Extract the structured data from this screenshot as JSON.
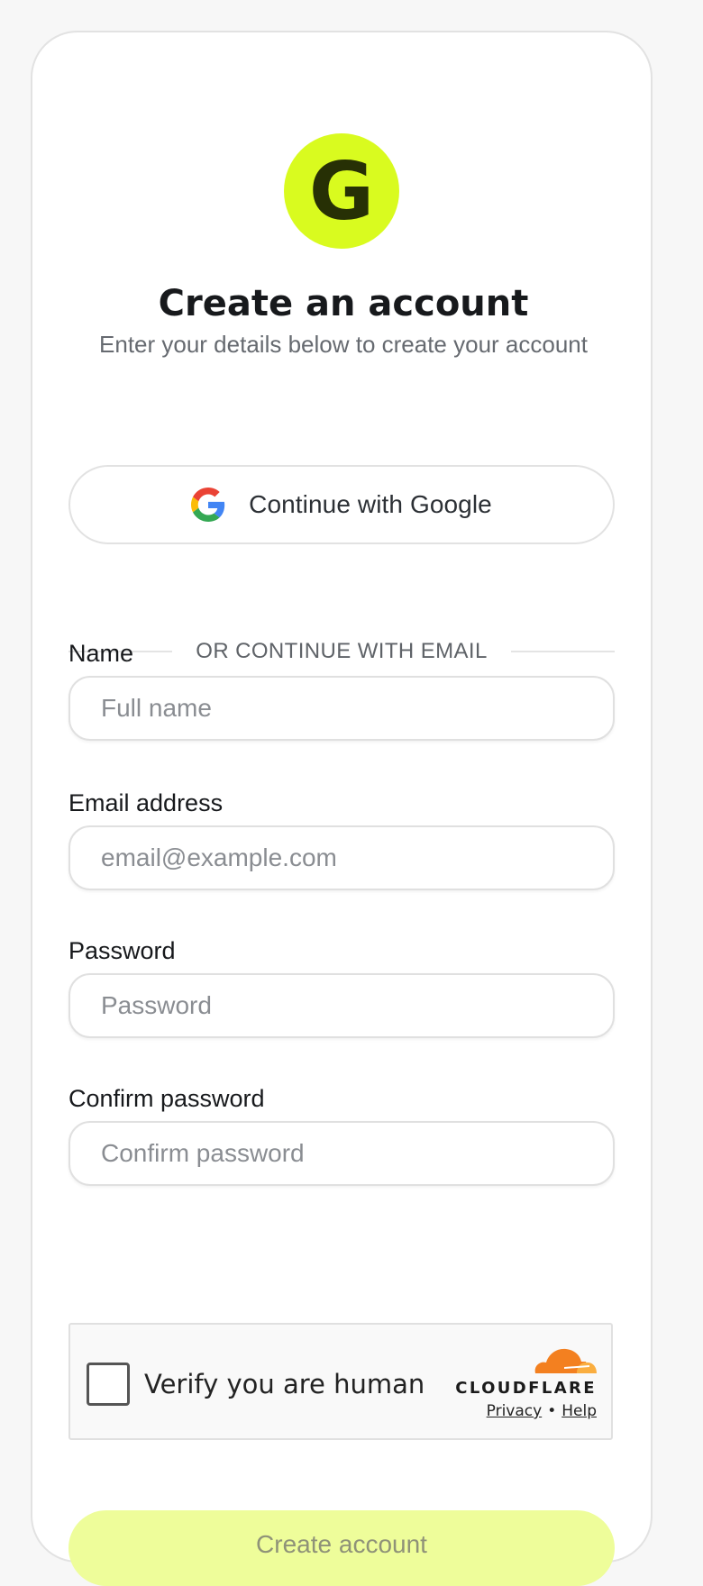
{
  "logo": {
    "letter": "G",
    "color": "#d9fb1f"
  },
  "header": {
    "title": "Create an account",
    "subtitle": "Enter your details below to create your account"
  },
  "google_button": {
    "label": "Continue with Google",
    "icon": "google-g-icon"
  },
  "divider": {
    "text": "OR CONTINUE WITH EMAIL"
  },
  "form": {
    "name": {
      "label": "Name",
      "placeholder": "Full name",
      "value": ""
    },
    "email": {
      "label": "Email address",
      "placeholder": "email@example.com",
      "value": ""
    },
    "password": {
      "label": "Password",
      "placeholder": "Password",
      "value": ""
    },
    "confirm_password": {
      "label": "Confirm password",
      "placeholder": "Confirm password",
      "value": ""
    }
  },
  "captcha": {
    "label": "Verify you are human",
    "brand": "CLOUDFLARE",
    "privacy_link": "Privacy",
    "separator": "•",
    "help_link": "Help",
    "checked": false
  },
  "submit": {
    "label": "Create account",
    "color": "#eefd9a"
  }
}
